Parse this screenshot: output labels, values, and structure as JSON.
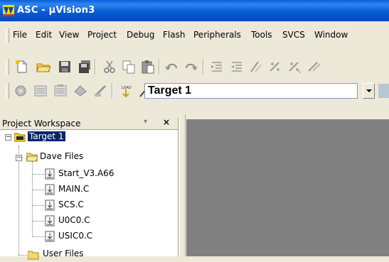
{
  "window": {
    "title": "ASC - µVision3",
    "title_color": "#0a5fd8"
  },
  "menu": {
    "items": [
      {
        "label": "File"
      },
      {
        "label": "Edit"
      },
      {
        "label": "View"
      },
      {
        "label": "Project"
      },
      {
        "label": "Debug"
      },
      {
        "label": "Flash"
      },
      {
        "label": "Peripherals"
      },
      {
        "label": "Tools"
      },
      {
        "label": "SVCS"
      },
      {
        "label": "Window"
      }
    ]
  },
  "toolbar1": {
    "icons": [
      "new-file-icon",
      "open-folder-icon",
      "save-icon",
      "save-all-icon",
      "cut-icon",
      "copy-icon",
      "paste-icon",
      "undo-icon",
      "redo-icon",
      "indent-icon",
      "outdent-icon",
      "comment-icon",
      "uncomment-icon",
      "bookmark-icon"
    ]
  },
  "toolbar2": {
    "icons": [
      "translate-icon",
      "build-icon",
      "rebuild-icon",
      "batch-build-icon",
      "stop-build-icon",
      "download-icon",
      "target-options-icon"
    ],
    "target_select": "Target 1"
  },
  "workspace": {
    "title": "Project Workspace",
    "tree": {
      "root": "Target 1",
      "groups": [
        {
          "name": "Dave Files",
          "files": [
            "Start_V3.A66",
            "MAIN.C",
            "SCS.C",
            "U0C0.C",
            "USIC0.C"
          ]
        },
        {
          "name": "User Files",
          "files": []
        }
      ]
    }
  },
  "colors": {
    "selection": "#0a246a",
    "editor_background": "#808080",
    "chrome": "#ece9d8"
  }
}
